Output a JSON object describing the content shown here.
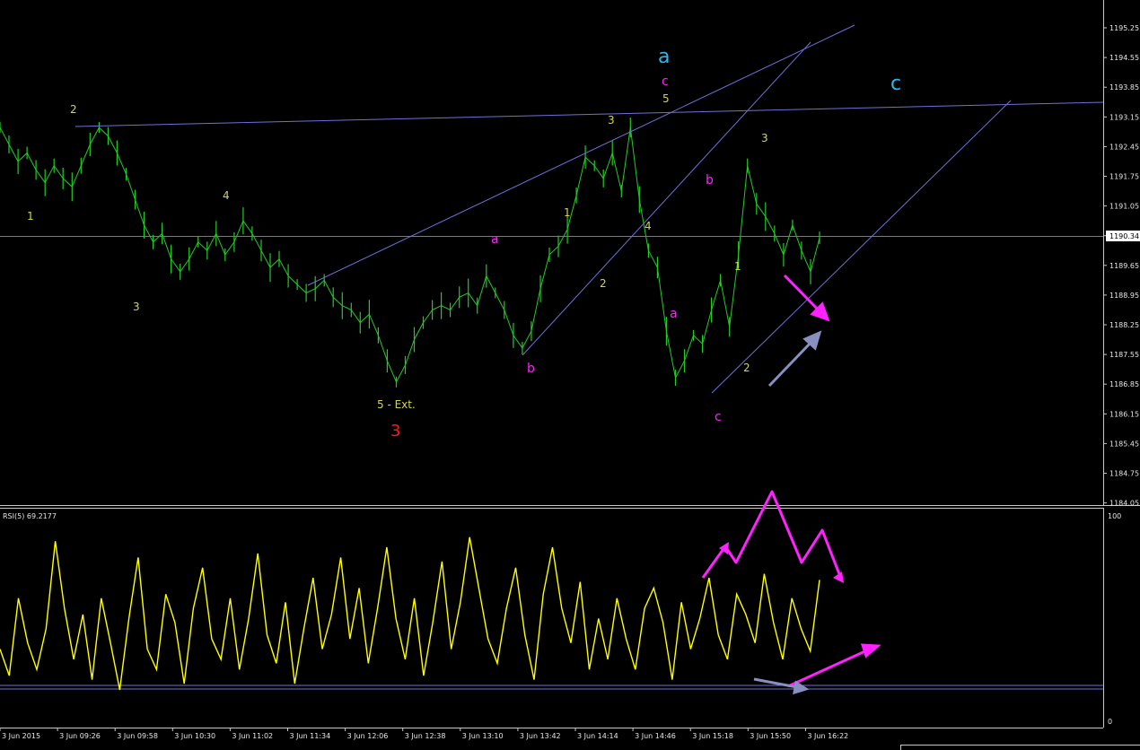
{
  "colors": {
    "background": "#000000",
    "candles": "#22cc22",
    "rsi_line": "#ffff00",
    "trendlines": "#6f6fd8",
    "axis": "#c8c8c8",
    "current_price_bg": "#ffffff",
    "magenta": "#ff22ff",
    "cyan": "#2ab7f0",
    "yellow_label": "#d6d640",
    "red_label": "#ff1a1a",
    "gray_arrow": "#8890c0"
  },
  "price_panel": {
    "y_ticks": [
      "1195.25",
      "1194.55",
      "1193.85",
      "1193.15",
      "1192.45",
      "1191.75",
      "1191.05",
      "1190.34",
      "1189.65",
      "1188.95",
      "1188.25",
      "1187.55",
      "1186.85",
      "1186.15",
      "1185.45",
      "1184.75",
      "1184.05"
    ],
    "current_price": "1190.34"
  },
  "rsi_panel": {
    "title": "RSI(5) 69.2177",
    "y_ticks": [
      "100",
      "0"
    ]
  },
  "x_ticks": [
    "3 Jun 2015",
    "3 Jun 09:26",
    "3 Jun 09:58",
    "3 Jun 10:30",
    "3 Jun 11:02",
    "3 Jun 11:34",
    "3 Jun 12:06",
    "3 Jun 12:38",
    "3 Jun 13:10",
    "3 Jun 13:42",
    "3 Jun 14:14",
    "3 Jun 14:46",
    "3 Jun 15:18",
    "3 Jun 15:50",
    "3 Jun 16:22"
  ],
  "wave_labels": {
    "w1": "1",
    "w2": "2",
    "w3": "3",
    "w4": "4",
    "w5ext": "5 - Ext.",
    "big3": "3",
    "a1": "a",
    "b1": "b",
    "i1": "1",
    "i2": "2",
    "i3": "3",
    "i4": "4",
    "i5": "5",
    "cc": "c",
    "big_a": "a",
    "big_c": "c",
    "a2": "a",
    "b2": "b",
    "c2": "c",
    "j1": "1",
    "j2": "2",
    "j3": "3"
  },
  "chart_data": {
    "type": "line",
    "series": [
      {
        "values": [
          1192.9,
          1192.5,
          1192.1,
          1192.3,
          1191.9,
          1191.6,
          1192.0,
          1191.7,
          1191.5,
          1192.0,
          1192.5,
          1192.9,
          1192.7,
          1192.3,
          1191.8,
          1191.2,
          1190.6,
          1190.2,
          1190.4,
          1189.8,
          1189.5,
          1189.8,
          1190.2,
          1190.0,
          1190.4,
          1189.9,
          1190.2,
          1190.7,
          1190.4,
          1190.0,
          1189.6,
          1189.8,
          1189.4,
          1189.2,
          1189.0,
          1189.1,
          1189.3,
          1188.9,
          1188.7,
          1188.6,
          1188.3,
          1188.5,
          1188.0,
          1187.4,
          1186.9,
          1187.3,
          1187.9,
          1188.3,
          1188.6,
          1188.7,
          1188.6,
          1188.9,
          1189.0,
          1188.7,
          1189.4,
          1189.0,
          1188.6,
          1188.0,
          1187.7,
          1188.1,
          1189.1,
          1189.9,
          1190.1,
          1190.5,
          1191.3,
          1192.2,
          1192.0,
          1191.7,
          1192.3,
          1191.4,
          1192.9,
          1191.2,
          1190.0,
          1189.6,
          1188.1,
          1187.0,
          1187.4,
          1188.0,
          1187.8,
          1188.6,
          1189.3,
          1188.2,
          1189.9,
          1192.0,
          1191.1,
          1190.8,
          1190.4,
          1189.9,
          1190.6,
          1190.0,
          1189.5,
          1190.3
        ],
        "x_range": [
          "3 Jun 2015 09:00",
          "3 Jun 16:25"
        ]
      },
      {
        "name": "RSI(5) 69.2177",
        "values": [
          35,
          22,
          60,
          38,
          25,
          45,
          88,
          55,
          30,
          52,
          20,
          60,
          38,
          15,
          50,
          80,
          35,
          25,
          62,
          48,
          18,
          55,
          75,
          40,
          30,
          60,
          25,
          50,
          82,
          42,
          28,
          58,
          18,
          45,
          70,
          35,
          52,
          80,
          40,
          65,
          28,
          55,
          85,
          50,
          30,
          60,
          22,
          48,
          78,
          35,
          58,
          90,
          65,
          40,
          28,
          55,
          75,
          42,
          20,
          62,
          85,
          55,
          38,
          68,
          25,
          50,
          30,
          60,
          40,
          25,
          55,
          65,
          48,
          20,
          58,
          35,
          50,
          70,
          42,
          30,
          62,
          52,
          38,
          72,
          48,
          30,
          60,
          45,
          34,
          69
        ]
      }
    ],
    "ylim": [
      1184.05,
      1195.6
    ],
    "rsi_ylim": [
      0,
      100
    ]
  }
}
